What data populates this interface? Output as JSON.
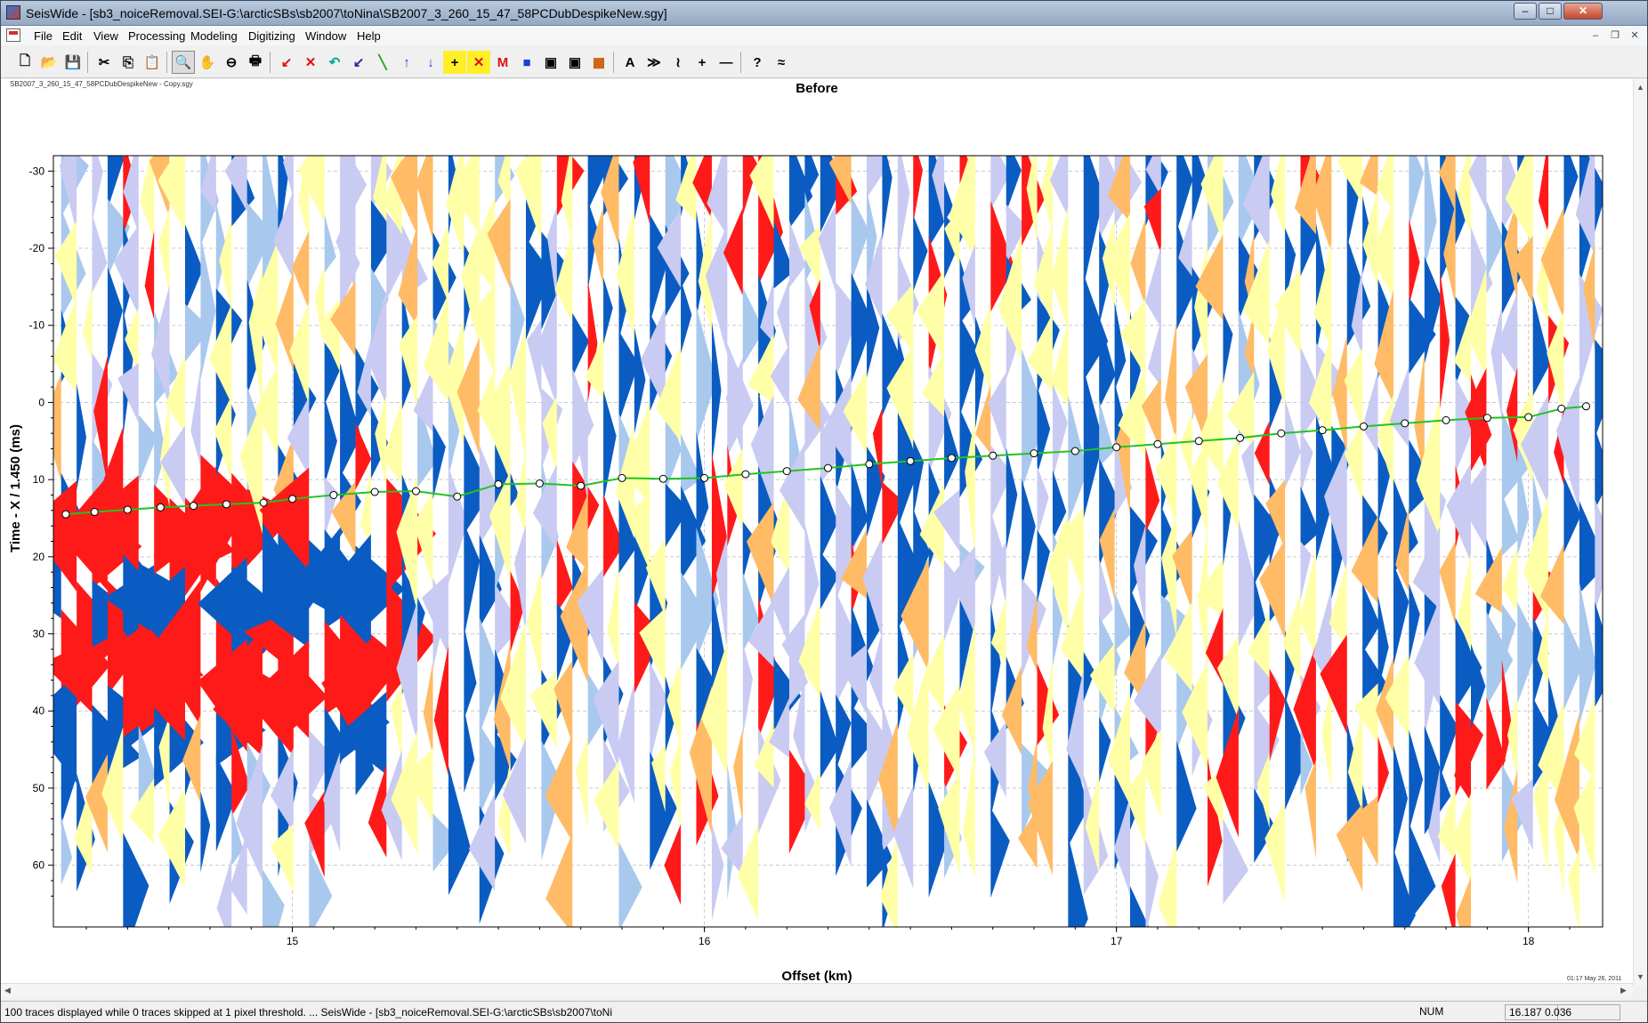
{
  "window": {
    "title": "SeisWide - [sb3_noiceRemoval.SEI-G:\\arcticSBs\\sb2007\\toNina\\SB2007_3_260_15_47_58PCDubDespikeNew.sgy]",
    "controls": [
      "–",
      "□",
      "✕"
    ]
  },
  "menu": {
    "items": [
      "File",
      "Edit",
      "View",
      "Processing",
      "Modeling",
      "Digitizing",
      "Window",
      "Help"
    ],
    "mdi_controls": [
      "–",
      "❐",
      "✕"
    ]
  },
  "toolbar": {
    "buttons": [
      {
        "name": "new-icon",
        "glyph": "🗋"
      },
      {
        "name": "open-icon",
        "glyph": "📂"
      },
      {
        "name": "save-icon",
        "glyph": "💾"
      },
      {
        "name": "cut-icon",
        "glyph": "✂"
      },
      {
        "name": "copy-icon",
        "glyph": "⎘"
      },
      {
        "name": "paste-icon",
        "glyph": "📋"
      },
      {
        "name": "zoom-icon",
        "glyph": "🔍"
      },
      {
        "name": "pan-hand-icon",
        "glyph": "✋"
      },
      {
        "name": "zoom-out-icon",
        "glyph": "⊖"
      },
      {
        "name": "print-icon",
        "glyph": "🖶"
      },
      {
        "name": "pick-red-icon",
        "glyph": "↙"
      },
      {
        "name": "delete-point-icon",
        "glyph": "✕"
      },
      {
        "name": "undo-icon",
        "glyph": "↶"
      },
      {
        "name": "pick-blue-icon",
        "glyph": "↙"
      },
      {
        "name": "line-draw-icon",
        "glyph": "╲"
      },
      {
        "name": "arrow-up-icon",
        "glyph": "↑"
      },
      {
        "name": "arrow-down-icon",
        "glyph": "↓"
      },
      {
        "name": "add-point-icon",
        "glyph": "+"
      },
      {
        "name": "remove-point-icon",
        "glyph": "✕"
      },
      {
        "name": "model-icon",
        "glyph": "M"
      },
      {
        "name": "color-map-icon",
        "glyph": "■"
      },
      {
        "name": "save-image-icon",
        "glyph": "▣"
      },
      {
        "name": "export-image-icon",
        "glyph": "▣"
      },
      {
        "name": "noise-icon",
        "glyph": "▦"
      },
      {
        "name": "font-icon",
        "glyph": "A"
      },
      {
        "name": "wiggle-fast-icon",
        "glyph": "≫"
      },
      {
        "name": "wiggle-icon",
        "glyph": "≀"
      },
      {
        "name": "crosshair-icon",
        "glyph": "+"
      },
      {
        "name": "horizontal-line-icon",
        "glyph": "—"
      },
      {
        "name": "help-icon",
        "glyph": "?"
      },
      {
        "name": "wave-icon",
        "glyph": "≈"
      }
    ]
  },
  "document": {
    "file_label": "SB2007_3_260_15_47_58PCDubDespikeNew - Copy.sgy",
    "timestamp": "01:17 May 26, 2011"
  },
  "status": {
    "message": "100 traces displayed while 0 traces skipped at 1 pixel threshold. ... SeisWide - [sb3_noiceRemoval.SEI-G:\\arcticSBs\\sb2007\\toNi",
    "num": "NUM",
    "coords": "16.187  0.036"
  },
  "colors": {
    "blue": "#0a5cc2",
    "red": "#ff1a1a",
    "light_blue": "#a9c8ee",
    "lavender": "#c9cbf2",
    "yellow": "#ffffa8",
    "orange": "#ffbb66",
    "pick_line": "#22c322"
  },
  "chart_data": {
    "type": "scatter",
    "title": "Before",
    "xlabel": "Offset (km)",
    "ylabel": "Time - X / 1.450 (ms)",
    "xlim": [
      14.42,
      18.18
    ],
    "ylim": [
      -32,
      68
    ],
    "y_inverted": true,
    "grid": true,
    "xticks": [
      15,
      16,
      17,
      18
    ],
    "yticks": [
      -30,
      -20,
      -10,
      0,
      10,
      20,
      30,
      40,
      50,
      60
    ],
    "n_traces": 100,
    "series": [
      {
        "x": [
          14.45,
          14.52,
          14.6,
          14.68,
          14.76,
          14.84,
          14.93,
          15.0,
          15.1,
          15.2,
          15.3,
          15.4,
          15.5,
          15.6,
          15.7,
          15.8,
          15.9,
          16.0,
          16.1,
          16.2,
          16.3,
          16.4,
          16.5,
          16.6,
          16.7,
          16.8,
          16.9,
          17.0,
          17.1,
          17.2,
          17.3,
          17.4,
          17.5,
          17.6,
          17.7,
          17.8,
          17.9,
          18.0,
          18.08,
          18.14
        ],
        "y": [
          14.5,
          14.2,
          13.9,
          13.6,
          13.4,
          13.2,
          13.0,
          12.5,
          12.0,
          11.6,
          11.5,
          12.2,
          10.6,
          10.5,
          10.8,
          9.8,
          9.9,
          9.8,
          9.3,
          8.9,
          8.5,
          8.0,
          7.6,
          7.2,
          6.9,
          6.6,
          6.3,
          5.8,
          5.4,
          5.0,
          4.6,
          4.0,
          3.6,
          3.1,
          2.7,
          2.3,
          2.0,
          1.9,
          0.8,
          0.5
        ]
      }
    ]
  }
}
